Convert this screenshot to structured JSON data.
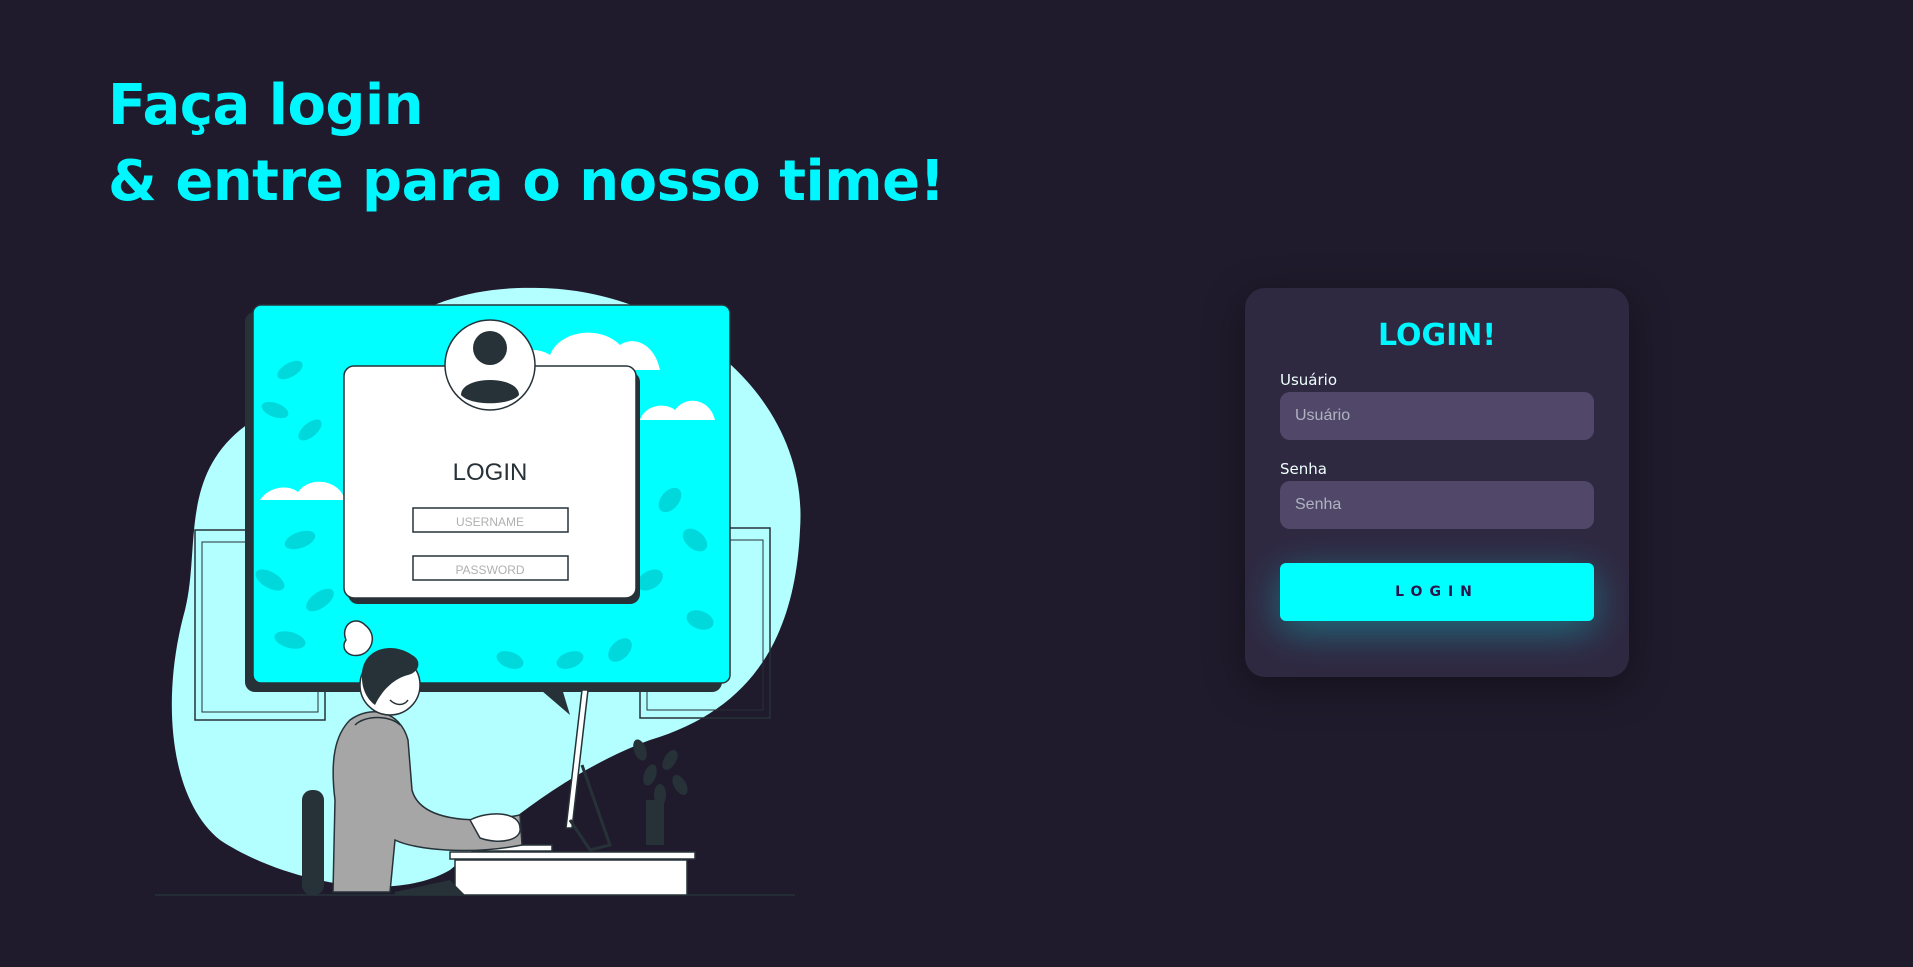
{
  "headline": {
    "line1": "Faça login",
    "line2": "& entre para o nosso time!"
  },
  "illustration": {
    "screen_title": "LOGIN",
    "username_placeholder": "USERNAME",
    "password_placeholder": "PASSWORD"
  },
  "login_card": {
    "title": "LOGIN!",
    "username_label": "Usuário",
    "username_placeholder": "Usuário",
    "password_label": "Senha",
    "password_placeholder": "Senha",
    "button_label": "LOGIN"
  },
  "colors": {
    "background": "#201b2c",
    "accent": "#00f7ff",
    "card": "#2f2841",
    "input": "#514869"
  }
}
